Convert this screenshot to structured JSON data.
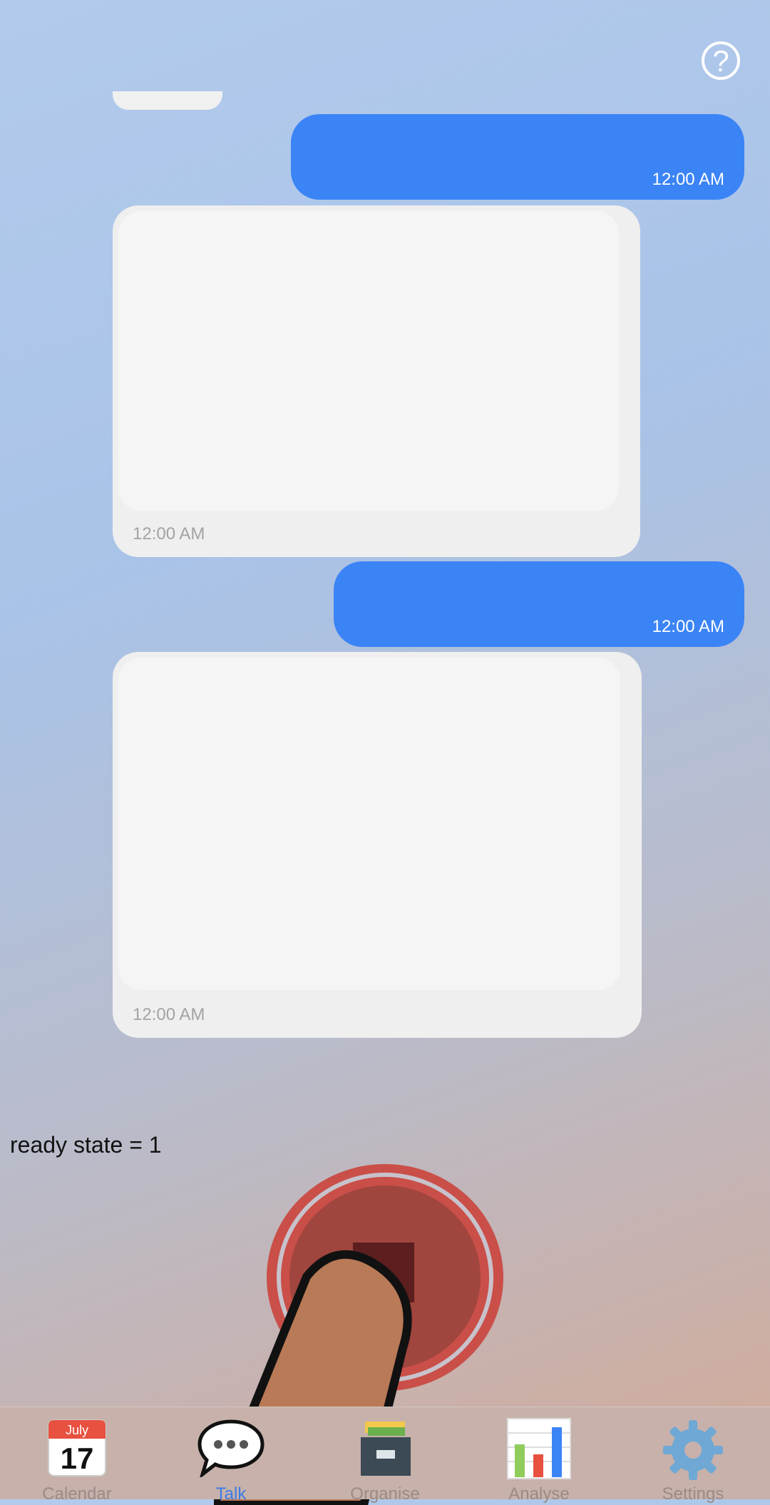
{
  "header": {
    "help_icon": "?"
  },
  "messages": [
    {
      "id": "out-1",
      "direction": "outgoing",
      "time": "12:00 AM"
    },
    {
      "id": "in-1",
      "direction": "incoming",
      "time": "12:00 AM"
    },
    {
      "id": "out-2",
      "direction": "outgoing",
      "time": "12:00 AM"
    },
    {
      "id": "in-2",
      "direction": "incoming",
      "time": "12:00 AM"
    }
  ],
  "status": {
    "ready_text": "ready state = 1"
  },
  "record_button": {
    "icon": "stop-recording-icon",
    "color": "#c94f48"
  },
  "tabbar": {
    "tabs": [
      {
        "label": "Calendar",
        "icon": "calendar-icon",
        "day": "17",
        "month": "July"
      },
      {
        "label": "Talk",
        "icon": "speech-bubble-icon",
        "active": true
      },
      {
        "label": "Organise",
        "icon": "file-cabinet-icon"
      },
      {
        "label": "Analyse",
        "icon": "bar-chart-icon"
      },
      {
        "label": "Settings",
        "icon": "gear-icon"
      }
    ]
  },
  "colors": {
    "accent": "#3b84f6",
    "active_tab": "#3b7be6"
  }
}
